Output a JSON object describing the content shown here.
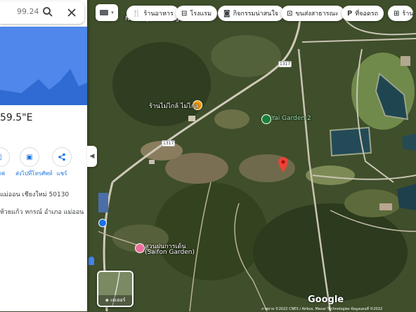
{
  "search": {
    "value": "99.24"
  },
  "location": {
    "coords_fragment": "59.5\"E"
  },
  "actions": [
    {
      "label": "เซฟ"
    },
    {
      "label": "ส่งไปที่โทรศัพท์"
    },
    {
      "label": "แชร์"
    }
  ],
  "address": {
    "line1": "แม่ออน เชียงใหม่ 50130",
    "line2": "ห้วยแก้ว หกรณ์ อำเภอ แม่ออน"
  },
  "chips": [
    {
      "icon": "restaurant-icon",
      "label": "ร้านอาหาร"
    },
    {
      "icon": "hotel-icon",
      "label": "โรงแรม"
    },
    {
      "icon": "camera-icon",
      "label": "กิจกรรมน่าสนใจ"
    },
    {
      "icon": "bus-icon",
      "label": "ขนส่งสาธารณะ"
    },
    {
      "icon": "parking-icon",
      "label": "ที่จอดรถ"
    },
    {
      "icon": "shop-icon",
      "label": "ร้าน"
    }
  ],
  "map": {
    "places": [
      {
        "name": "Nursery Seedlings Center"
      },
      {
        "name": "ร้านไม่ไกล้ ไม่ไกล"
      },
      {
        "name": "Yai Garden 2"
      },
      {
        "name": "สวนฝนการเด้น"
      },
      {
        "name": "(Saifon Garden)"
      }
    ],
    "road_numbers": [
      "1317",
      "1317"
    ],
    "branding": "Google",
    "layers_label": "เลเยอร์",
    "attribution": "ภาพถ่าย ©2022 CNES / Airbus, Maxar Technologies ข้อมูลแผนที่ ©2022"
  },
  "colors": {
    "pin": "#ea4335",
    "accent": "#1a73e8",
    "elevation": "#4f87ea"
  }
}
